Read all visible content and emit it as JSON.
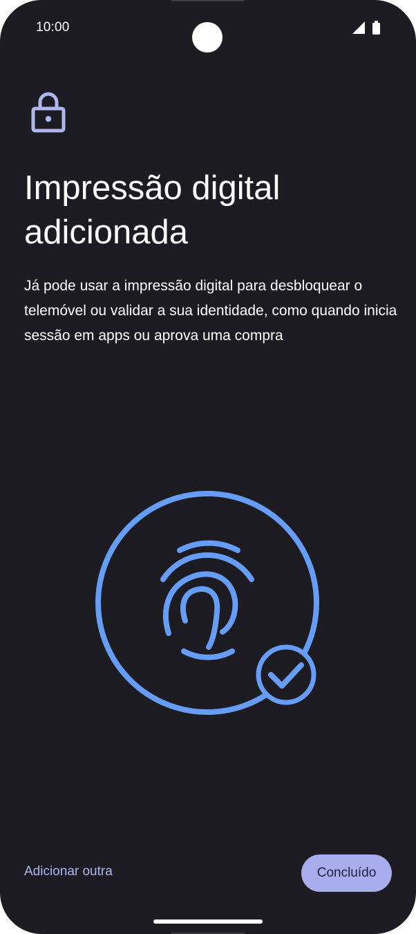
{
  "status_bar": {
    "time": "10:00",
    "icons": [
      "signal-icon",
      "battery-icon"
    ]
  },
  "header": {
    "icon": "lock-icon",
    "title": "Impressão digital adicionada",
    "description": "Já pode usar a impressão digital para desbloquear o telemóvel ou validar a sua identidade, como quando inicia sessão em apps ou aprova uma compra"
  },
  "illustration": {
    "icon": "fingerprint-check-icon",
    "accent_color": "#669df6"
  },
  "actions": {
    "secondary_label": "Adicionar outra",
    "primary_label": "Concluído"
  },
  "colors": {
    "background": "#1d1c22",
    "lock_color": "#b0b6ee",
    "primary_button": "#a8aeed",
    "primary_button_text": "#1c1e3c",
    "link_text": "#b0b6ee"
  }
}
